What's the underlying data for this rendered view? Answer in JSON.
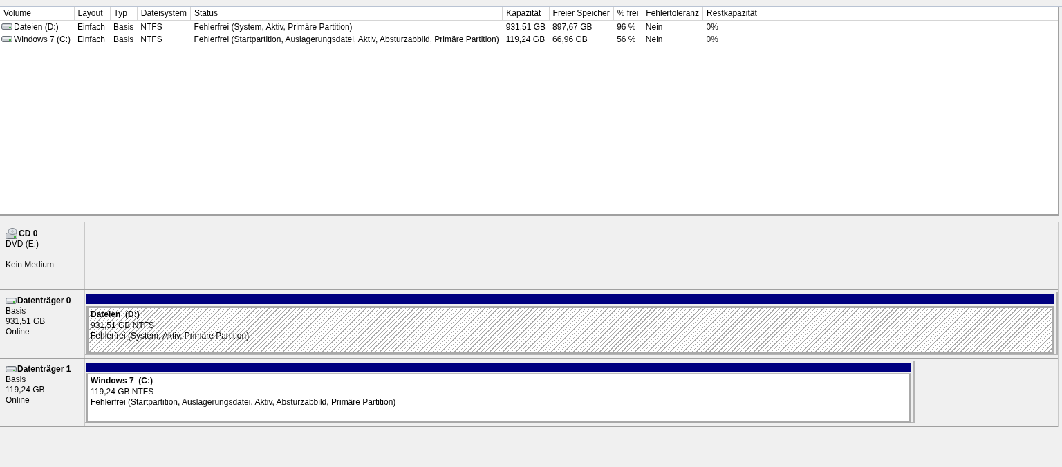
{
  "volume_list": {
    "columns": [
      "Volume",
      "Layout",
      "Typ",
      "Dateisystem",
      "Status",
      "Kapazität",
      "Freier Speicher",
      "% frei",
      "Fehlertoleranz",
      "Restkapazität"
    ],
    "rows": [
      [
        "Dateien (D:)",
        "Einfach",
        "Basis",
        "NTFS",
        "Fehlerfrei (System, Aktiv, Primäre Partition)",
        "931,51 GB",
        "897,67 GB",
        "96 %",
        "Nein",
        "0%"
      ],
      [
        "Windows 7 (C:)",
        "Einfach",
        "Basis",
        "NTFS",
        "Fehlerfrei (Startpartition, Auslagerungsdatei, Aktiv, Absturzabbild, Primäre Partition)",
        "119,24 GB",
        "66,96 GB",
        "56 %",
        "Nein",
        "0%"
      ]
    ]
  },
  "disks": [
    {
      "kind": "cd",
      "name": "CD 0",
      "type": "DVD (E:)",
      "status": "Kein Medium"
    },
    {
      "kind": "disk",
      "name": "Datenträger 0",
      "type": "Basis",
      "size": "931,51 GB",
      "status": "Online",
      "partitions": [
        {
          "name": "Dateien  (D:)",
          "size": "931,51 GB NTFS",
          "status": "Fehlerfrei (System, Aktiv, Primäre Partition)",
          "selected": true
        }
      ]
    },
    {
      "kind": "disk",
      "name": "Datenträger 1",
      "type": "Basis",
      "size": "119,24 GB",
      "status": "Online",
      "partitions": [
        {
          "name": "Windows 7  (C:)",
          "size": "119,24 GB NTFS",
          "status": "Fehlerfrei (Startpartition, Auslagerungsdatei, Aktiv, Absturzabbild, Primäre Partition)",
          "selected": false
        }
      ]
    }
  ]
}
